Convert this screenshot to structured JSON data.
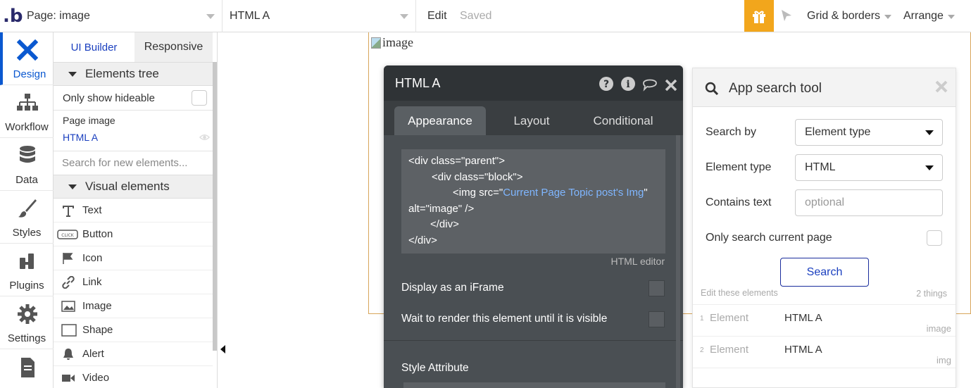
{
  "topbar": {
    "logo": ".b",
    "page_dropdown": "Page: image",
    "element_dropdown": "HTML A",
    "edit": "Edit",
    "saved": "Saved",
    "grid_borders": "Grid & borders",
    "arrange": "Arrange"
  },
  "nav": [
    {
      "label": "Design",
      "icon": "design-icon"
    },
    {
      "label": "Workflow",
      "icon": "workflow-icon"
    },
    {
      "label": "Data",
      "icon": "database-icon"
    },
    {
      "label": "Styles",
      "icon": "brush-icon"
    },
    {
      "label": "Plugins",
      "icon": "plug-icon"
    },
    {
      "label": "Settings",
      "icon": "gear-icon"
    }
  ],
  "panel": {
    "tab_ui": "UI Builder",
    "tab_responsive": "Responsive",
    "elements_tree": "Elements tree",
    "only_show_hideable": "Only show hideable",
    "page_item": "Page image",
    "selected_item": "HTML A",
    "search_placeholder": "Search for new elements...",
    "visual_elements": "Visual elements",
    "elements": [
      "Text",
      "Button",
      "Icon",
      "Link",
      "Image",
      "Shape",
      "Alert",
      "Video"
    ]
  },
  "canvas": {
    "image_alt": "image"
  },
  "editor": {
    "title": "HTML A",
    "tabs": [
      "Appearance",
      "Layout",
      "Conditional"
    ],
    "code_line1": "<div class=\"parent\">",
    "code_line2": "<div class=\"block\">",
    "code_line3_pre": "<img src=\"",
    "code_dynamic": "Current Page Topic post's Img",
    "code_line3_post": "\"",
    "code_line4": "alt=\"image\" />",
    "code_line5": "</div>",
    "code_line6": "</div>",
    "html_editor_label": "HTML editor",
    "display_iframe": "Display as an iFrame",
    "wait_render": "Wait to render this element until it is visible",
    "style_attribute": "Style Attribute"
  },
  "search_tool": {
    "title": "App search tool",
    "search_by_label": "Search by",
    "search_by_value": "Element type",
    "element_type_label": "Element type",
    "element_type_value": "HTML",
    "contains_text_label": "Contains text",
    "contains_text_placeholder": "optional",
    "only_current_page": "Only search current page",
    "search_button": "Search",
    "edit_these": "Edit these elements",
    "things_count": "2 things",
    "results": [
      {
        "num": "1",
        "key": "Element",
        "value": "HTML A",
        "sub": "image"
      },
      {
        "num": "2",
        "key": "Element",
        "value": "HTML A",
        "sub": "img"
      }
    ]
  },
  "colors": {
    "accent_blue": "#0a58d0",
    "gift_orange": "#f2a61c",
    "editor_dark": "#4a4f53",
    "dynamic_text": "#7fb6ff"
  }
}
